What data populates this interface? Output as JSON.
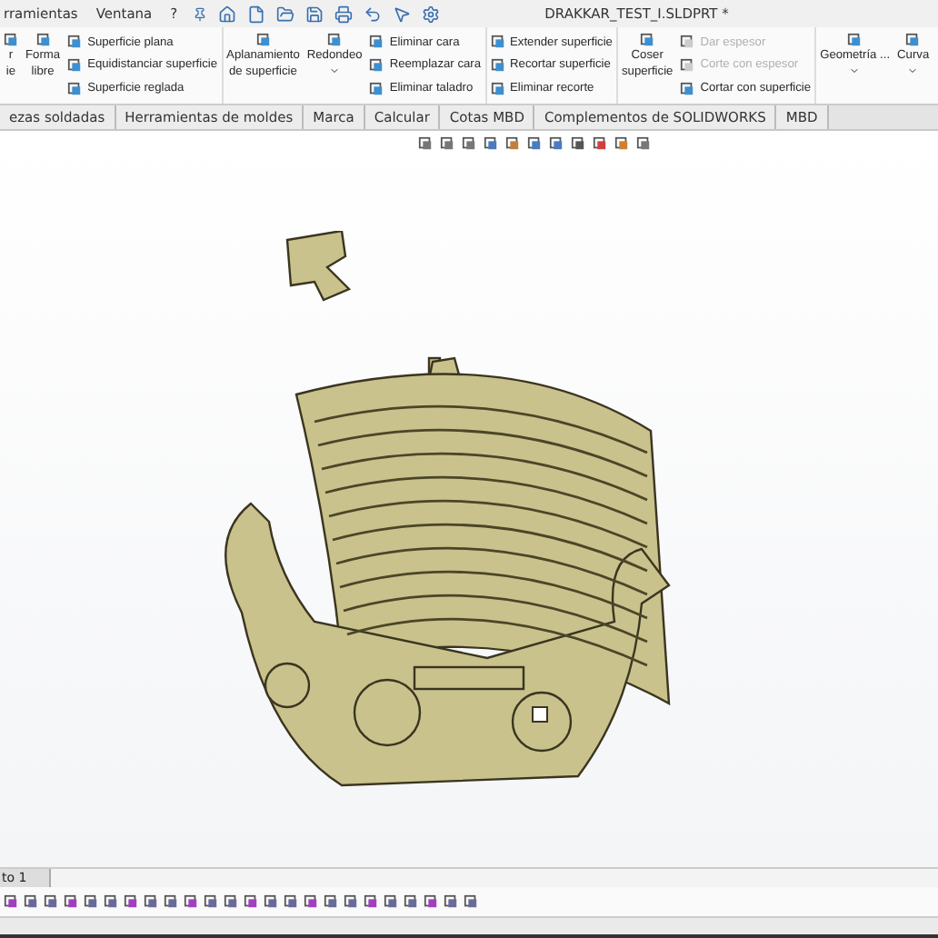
{
  "menu": [
    "rramientas",
    "Ventana",
    "?"
  ],
  "window": {
    "title": "DRAKKAR_TEST_I.SLDPRT *"
  },
  "ribbon": [
    {
      "kind": "large",
      "lines": [
        "r",
        "ie"
      ]
    },
    {
      "kind": "large",
      "lines": [
        "Forma",
        "libre"
      ]
    },
    {
      "kind": "stack",
      "items": [
        {
          "label": "Superficie plana",
          "disabled": false
        },
        {
          "label": "Equidistanciar superficie",
          "disabled": false
        },
        {
          "label": "Superficie reglada",
          "disabled": false
        }
      ]
    },
    {
      "kind": "large",
      "lines": [
        "Aplanamiento",
        "de superficie"
      ]
    },
    {
      "kind": "dropdown",
      "lines": [
        "Redondeo"
      ]
    },
    {
      "kind": "stack",
      "items": [
        {
          "label": "Eliminar cara",
          "disabled": false
        },
        {
          "label": "Reemplazar cara",
          "disabled": false
        },
        {
          "label": "Eliminar taladro",
          "disabled": false
        }
      ]
    },
    {
      "kind": "stack",
      "items": [
        {
          "label": "Extender superficie",
          "disabled": false
        },
        {
          "label": "Recortar superficie",
          "disabled": false
        },
        {
          "label": "Eliminar recorte",
          "disabled": false
        }
      ]
    },
    {
      "kind": "large",
      "lines": [
        "Coser",
        "superficie"
      ]
    },
    {
      "kind": "stack",
      "items": [
        {
          "label": "Dar espesor",
          "disabled": true
        },
        {
          "label": "Corte con espesor",
          "disabled": true
        },
        {
          "label": "Cortar con superficie",
          "disabled": false
        }
      ]
    },
    {
      "kind": "dropdown",
      "lines": [
        "Geometría ..."
      ]
    },
    {
      "kind": "dropdown",
      "lines": [
        "Curva"
      ]
    }
  ],
  "tabs": [
    "ezas soldadas",
    "Herramientas de moldes",
    "Marca",
    "Calcular",
    "Cotas MBD",
    "Complementos de SOLIDWORKS",
    "MBD"
  ],
  "sheet_tab": "to 1"
}
